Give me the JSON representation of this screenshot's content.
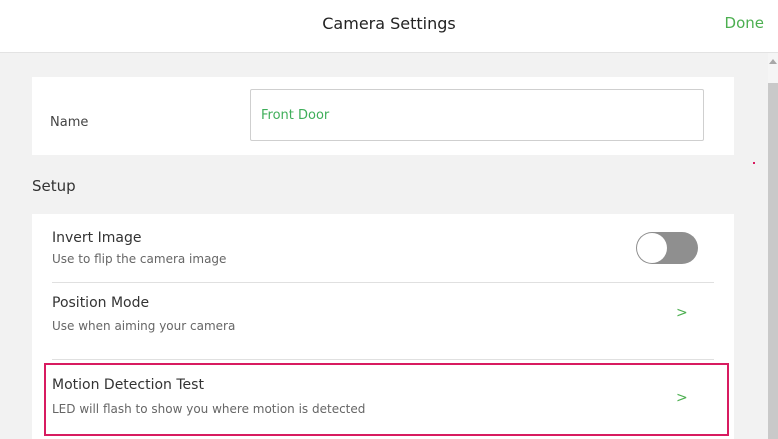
{
  "header": {
    "title": "Camera Settings",
    "done_label": "Done"
  },
  "name_section": {
    "label": "Name",
    "value": "Front Door"
  },
  "setup": {
    "heading": "Setup",
    "items": [
      {
        "title": "Invert Image",
        "subtitle": "Use to flip the camera image",
        "toggle_on": false
      },
      {
        "title": "Position Mode",
        "subtitle": "Use when aiming your camera",
        "chevron": ">"
      },
      {
        "title": "Motion Detection Test",
        "subtitle": "LED will flash to show you where motion is detected",
        "chevron": ">"
      }
    ]
  },
  "colors": {
    "accent": "#4caf50",
    "highlight": "#d81b60",
    "toggle_off": "#8f8f8f"
  }
}
